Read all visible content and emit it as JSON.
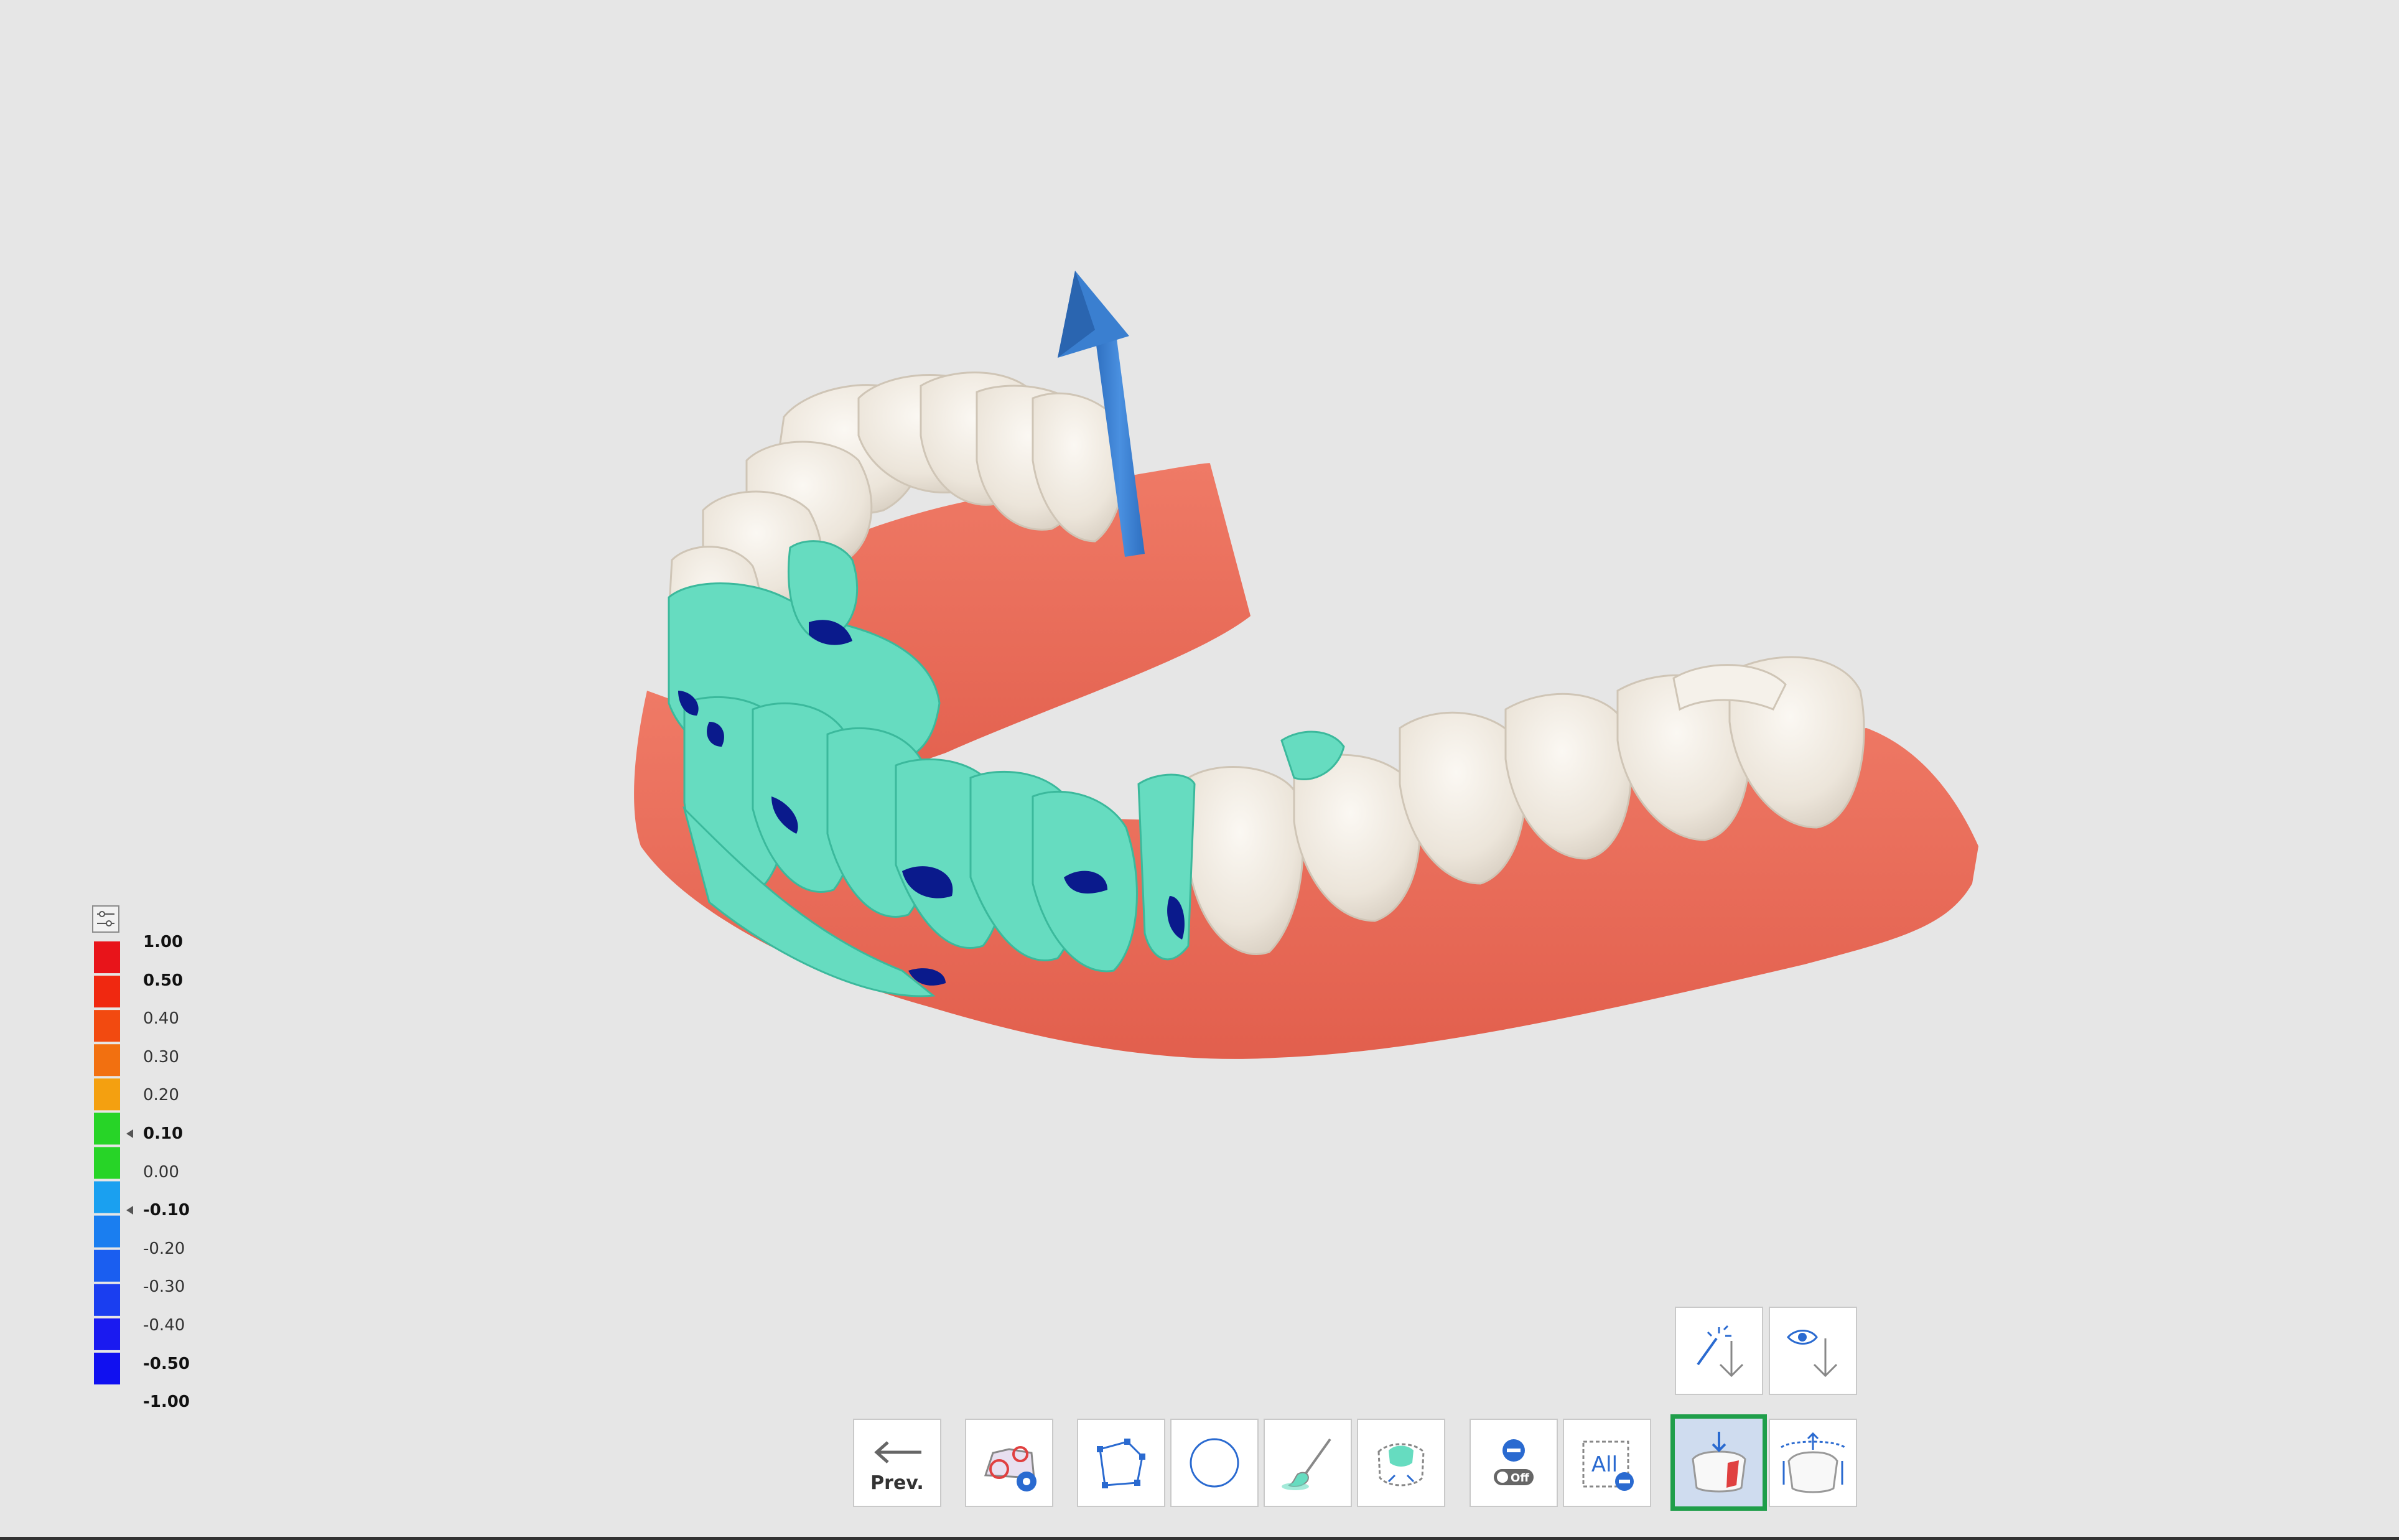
{
  "viewport": {
    "scene": "dental-arch-3d-model",
    "colors": {
      "background": "#e6e6e6",
      "gum": "#e96a58",
      "tooth": "#efe9df",
      "deviation_teal": "#66dcc0",
      "deviation_navy": "#0a1a8c",
      "arrow": "#3a7fd0"
    }
  },
  "legend": {
    "settings_icon": "sliders-icon",
    "labels": [
      {
        "text": "1.00",
        "bold": true
      },
      {
        "text": "0.50",
        "bold": true
      },
      {
        "text": "0.40",
        "bold": false
      },
      {
        "text": "0.30",
        "bold": false
      },
      {
        "text": "0.20",
        "bold": false
      },
      {
        "text": "0.10",
        "bold": true,
        "marker": true
      },
      {
        "text": "0.00",
        "bold": false
      },
      {
        "text": "-0.10",
        "bold": true,
        "marker": true
      },
      {
        "text": "-0.20",
        "bold": false
      },
      {
        "text": "-0.30",
        "bold": false
      },
      {
        "text": "-0.40",
        "bold": false
      },
      {
        "text": "-0.50",
        "bold": true
      },
      {
        "text": "-1.00",
        "bold": true
      }
    ],
    "colors": [
      "#e8141a",
      "#f02810",
      "#f24a10",
      "#f27010",
      "#f4a010",
      "#27d427",
      "#27d427",
      "#1aa0f0",
      "#1a7ef0",
      "#1a5ef0",
      "#1a3ef0",
      "#1a1af0",
      "#1010f0"
    ]
  },
  "toolbar": {
    "prev_label": "Prev.",
    "buttons": [
      {
        "name": "prev-button",
        "icon": "arrow-left-icon"
      },
      {
        "name": "scan-settings-button",
        "icon": "scan-settings-icon"
      },
      {
        "name": "polygon-select-button",
        "icon": "polygon-icon"
      },
      {
        "name": "circle-select-button",
        "icon": "circle-icon"
      },
      {
        "name": "brush-button",
        "icon": "brush-icon"
      },
      {
        "name": "smart-select-button",
        "icon": "smart-select-icon"
      },
      {
        "name": "remove-off-button",
        "icon": "remove-toggle-icon",
        "text": "Off"
      },
      {
        "name": "remove-all-button",
        "icon": "all-remove-icon",
        "text": "All"
      },
      {
        "name": "undercut-view-button",
        "icon": "undercut-icon",
        "active": true
      },
      {
        "name": "insertion-axis-button",
        "icon": "insertion-axis-icon"
      },
      {
        "name": "auto-direction-button",
        "icon": "magic-down-icon"
      },
      {
        "name": "view-direction-button",
        "icon": "eye-down-icon"
      }
    ]
  }
}
